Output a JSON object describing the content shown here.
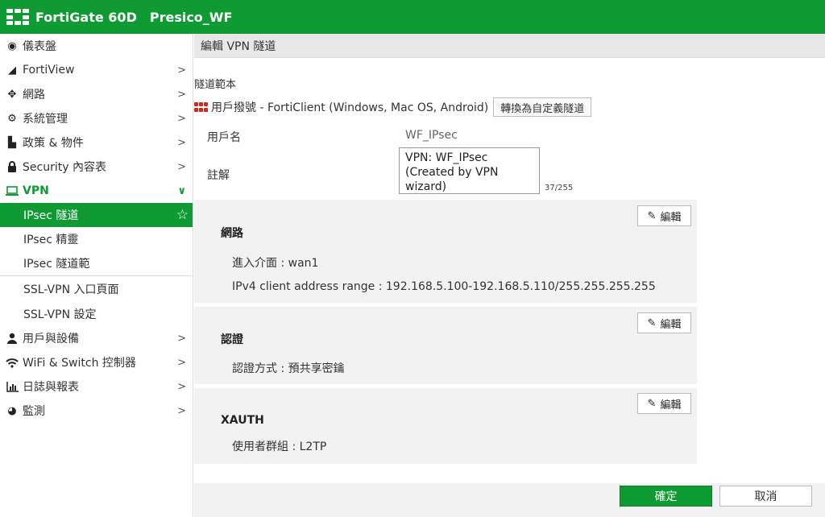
{
  "header": {
    "product": "FortiGate 60D",
    "device": "Presico_WF",
    "background": "#0f9a33"
  },
  "sidebar": {
    "items": [
      {
        "label": "儀表盤",
        "icon": "dashboard-icon"
      },
      {
        "label": "FortiView",
        "icon": "chart-icon",
        "chevron": ">"
      },
      {
        "label": "網路",
        "icon": "network-arrows-icon",
        "chevron": ">"
      },
      {
        "label": "系統管理",
        "icon": "gear-icon",
        "chevron": ">"
      },
      {
        "label": "政策 & 物件",
        "icon": "policy-icon",
        "chevron": ">"
      },
      {
        "label": "Security 內容表",
        "icon": "lock-icon",
        "chevron": ">"
      },
      {
        "label": "VPN",
        "icon": "laptop-icon",
        "chevron": "∨"
      },
      {
        "label": "用戶與設備",
        "icon": "user-icon",
        "chevron": ">"
      },
      {
        "label": "WiFi & Switch 控制器",
        "icon": "wifi-icon",
        "chevron": ">"
      },
      {
        "label": "日誌與報表",
        "icon": "bar-chart-icon",
        "chevron": ">"
      },
      {
        "label": "監測",
        "icon": "pie-chart-icon",
        "chevron": ">"
      }
    ],
    "vpn_sub": [
      {
        "label": "IPsec 隧道"
      },
      {
        "label": "IPsec 精靈"
      },
      {
        "label": "IPsec 隧道範"
      },
      {
        "label": "SSL-VPN 入口頁面"
      },
      {
        "label": "SSL-VPN 設定"
      }
    ]
  },
  "page": {
    "title": "編輯 VPN 隧道",
    "template_label": "隧道範本",
    "template_value": "用戶撥號 - FortiClient (Windows, Mac OS, Android)",
    "convert_button": "轉換為自定義隧道",
    "name_label": "用戶名",
    "name_value": "WF_IPsec",
    "comment_label": "註解",
    "comment_value": "VPN: WF_IPsec (Created by VPN wizard)",
    "comment_count": "37/255"
  },
  "sections": {
    "network": {
      "title": "網路",
      "edit": "編輯",
      "interface": "進入介面 : wan1",
      "range": "IPv4 client address range : 192.168.5.100-192.168.5.110/255.255.255.255"
    },
    "auth": {
      "title": "認證",
      "edit": "編輯",
      "method": "認證方式 : 預共享密鑰"
    },
    "xauth": {
      "title": "XAUTH",
      "edit": "編輯",
      "group": "使用者群組 : L2TP"
    }
  },
  "footer": {
    "ok": "確定",
    "cancel": "取消"
  }
}
